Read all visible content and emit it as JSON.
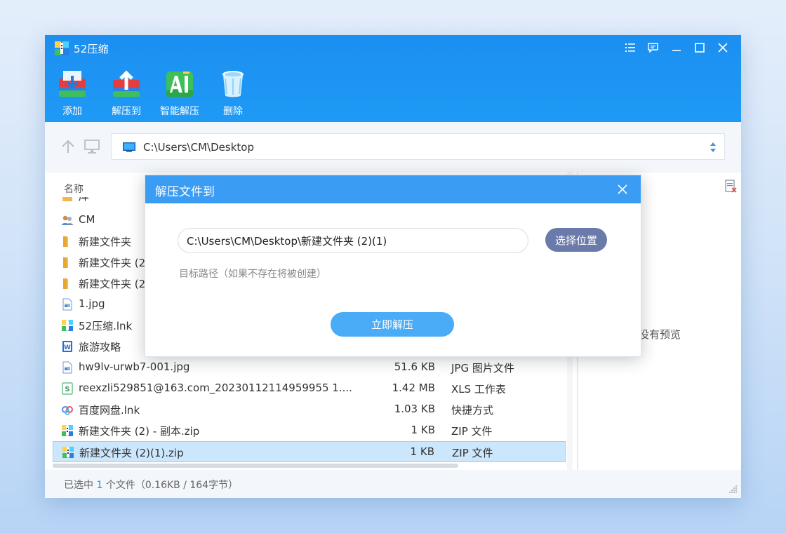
{
  "app": {
    "title": "52压缩",
    "brand_color": "#1e96f3"
  },
  "window_controls": [
    {
      "name": "menu-icon"
    },
    {
      "name": "feedback-icon"
    },
    {
      "name": "minimize-icon"
    },
    {
      "name": "maximize-icon"
    },
    {
      "name": "close-icon"
    }
  ],
  "toolbar": {
    "add_label": "添加",
    "extract_to_label": "解压到",
    "smart_extract_label": "智能解压",
    "delete_label": "删除"
  },
  "address": {
    "path": "C:\\Users\\CM\\Desktop"
  },
  "filelist": {
    "col_name": "名称",
    "partial_top": "库",
    "rows": [
      {
        "name": "CM",
        "size": "",
        "type": "",
        "icon": "user-folder-icon"
      },
      {
        "name": "新建文件夹",
        "size": "",
        "type": "",
        "icon": "folder-icon"
      },
      {
        "name": "新建文件夹 (2",
        "size": "",
        "type": "",
        "icon": "folder-icon"
      },
      {
        "name": "新建文件夹 (2",
        "size": "",
        "type": "",
        "icon": "folder-icon"
      },
      {
        "name": "1.jpg",
        "size": "",
        "type": "",
        "icon": "image-file-icon"
      },
      {
        "name": "52压缩.lnk",
        "size": "",
        "type": "",
        "icon": "app-shortcut-icon"
      },
      {
        "name": "旅游攻略",
        "size": "",
        "type": "",
        "icon": "word-doc-icon"
      },
      {
        "name": "hw9lv-urwb7-001.jpg",
        "size": "51.6 KB",
        "type": "JPG 图片文件",
        "icon": "image-file-icon"
      },
      {
        "name": "reexzli529851@163.com_20230112114959955 1....",
        "size": "1.42 MB",
        "type": "XLS 工作表",
        "icon": "excel-file-icon"
      },
      {
        "name": "百度网盘.lnk",
        "size": "1.03 KB",
        "type": "快捷方式",
        "icon": "baidu-netdisk-icon"
      },
      {
        "name": "新建文件夹 (2) - 副本.zip",
        "size": "1 KB",
        "type": "ZIP 文件",
        "icon": "zip-file-icon"
      },
      {
        "name": "新建文件夹 (2)(1).zip",
        "size": "1 KB",
        "type": "ZIP 文件",
        "icon": "zip-file-icon",
        "selected": true
      }
    ]
  },
  "preview": {
    "text": "没有预览"
  },
  "status": {
    "prefix": "已选中 ",
    "count": "1",
    "suffix": " 个文件（0.16KB / 164字节）"
  },
  "dialog": {
    "title": "解压文件到",
    "path_value": "C:\\Users\\CM\\Desktop\\新建文件夹 (2)(1)",
    "choose_label": "选择位置",
    "hint": "目标路径（如果不存在将被创建）",
    "extract_now_label": "立即解压",
    "header_color": "#3a9cf3"
  }
}
